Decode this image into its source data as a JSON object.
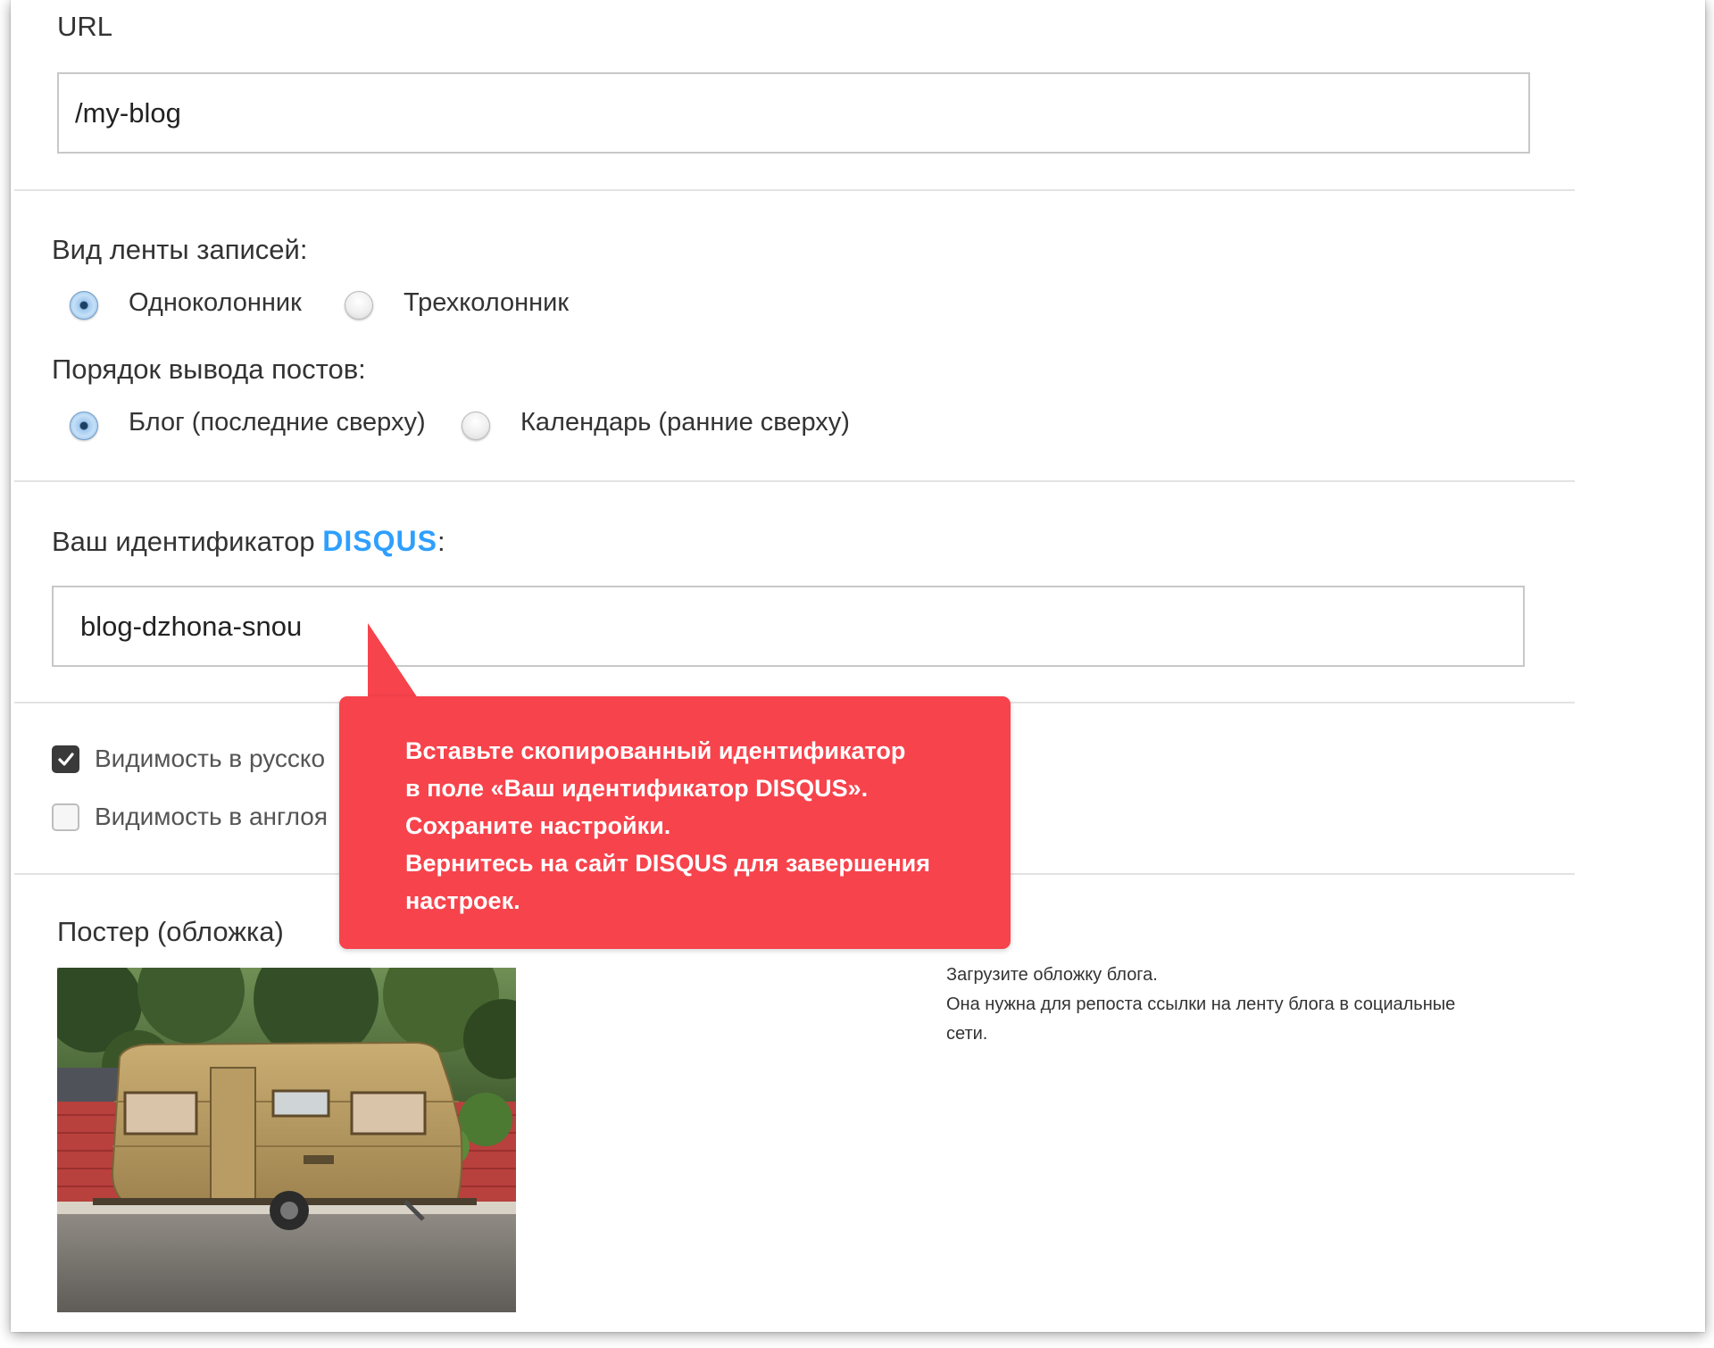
{
  "url_section": {
    "label": "URL",
    "value": "/my-blog"
  },
  "feed_view": {
    "label": "Вид ленты записей:",
    "options": [
      {
        "label": "Одноколонник",
        "selected": true
      },
      {
        "label": "Трехколонник",
        "selected": false
      }
    ]
  },
  "post_order": {
    "label": "Порядок вывода постов:",
    "options": [
      {
        "label": "Блог (последние сверху)",
        "selected": true
      },
      {
        "label": "Календарь (ранние сверху)",
        "selected": false
      }
    ]
  },
  "disqus": {
    "label_prefix": "Ваш идентификатор",
    "brand": "DISQUS",
    "label_suffix": ":",
    "value": "blog-dzhona-snou",
    "brand_color": "#2e9fff"
  },
  "visibility": {
    "russian": {
      "label": "Видимость в русско",
      "checked": true
    },
    "english": {
      "label": "Видимость в англоя",
      "checked": false
    }
  },
  "tooltip": {
    "lines": [
      "Вставьте скопированный идентификатор",
      "в поле «Ваш идентификатор DISQUS».",
      "Сохраните настройки.",
      "Вернитесь на сайт DISQUS для завершения",
      "настроек."
    ],
    "color": "#f7434c"
  },
  "poster": {
    "label": "Постер (обложка)",
    "help_lines": [
      "Загрузите обложку блога.",
      "Она нужна для репоста ссылки на ленту блога в социальные",
      "сети."
    ]
  }
}
